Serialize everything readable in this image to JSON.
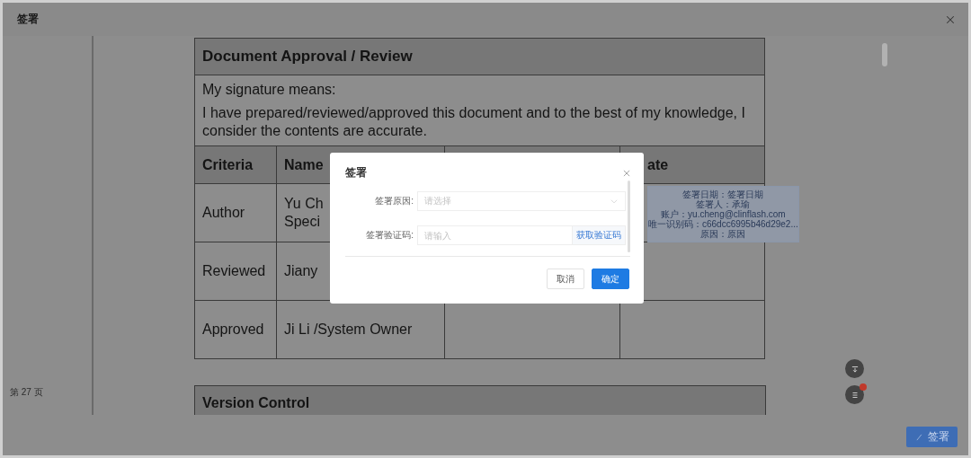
{
  "window": {
    "title": "签署"
  },
  "document": {
    "approval": {
      "heading": "Document Approval / Review",
      "lead": "My signature means:",
      "statement": "I have prepared/reviewed/approved this document and to the best of my knowledge, I consider the contents are accurate.",
      "columns": [
        {
          "label": "Criteria"
        },
        {
          "label": "Name"
        },
        {},
        {
          "label": "ate"
        }
      ],
      "rows": [
        {
          "criteria": "Author",
          "name": "Yu Ch\nSpeci",
          "signature": {
            "lines": [
              "签署日期：签署日期",
              "签署人：承瑜",
              "账户：yu.cheng@clinflash.com",
              "唯一识别码：c66dcc6995b46d29e2...",
              "原因：原因"
            ]
          }
        },
        {
          "criteria": "Reviewed",
          "name": "Jiany"
        },
        {
          "criteria": "Approved",
          "name": "Ji Li /System Owner"
        }
      ]
    },
    "version": {
      "heading": "Version Control"
    }
  },
  "page_number": "第 27 页",
  "float_buttons": [
    {
      "kind": "down",
      "badge": false
    },
    {
      "kind": "list",
      "badge": true
    }
  ],
  "sign_button": {
    "label": "签署"
  },
  "dialog": {
    "title": "签署",
    "fields": [
      {
        "kind": "select",
        "label": "签署原因:",
        "placeholder": "请选择"
      },
      {
        "kind": "code",
        "label": "签署验证码:",
        "placeholder": "请输入",
        "action": "获取验证码"
      }
    ],
    "buttons": [
      {
        "label": "取消",
        "primary": false
      },
      {
        "label": "确定",
        "primary": true
      }
    ]
  }
}
